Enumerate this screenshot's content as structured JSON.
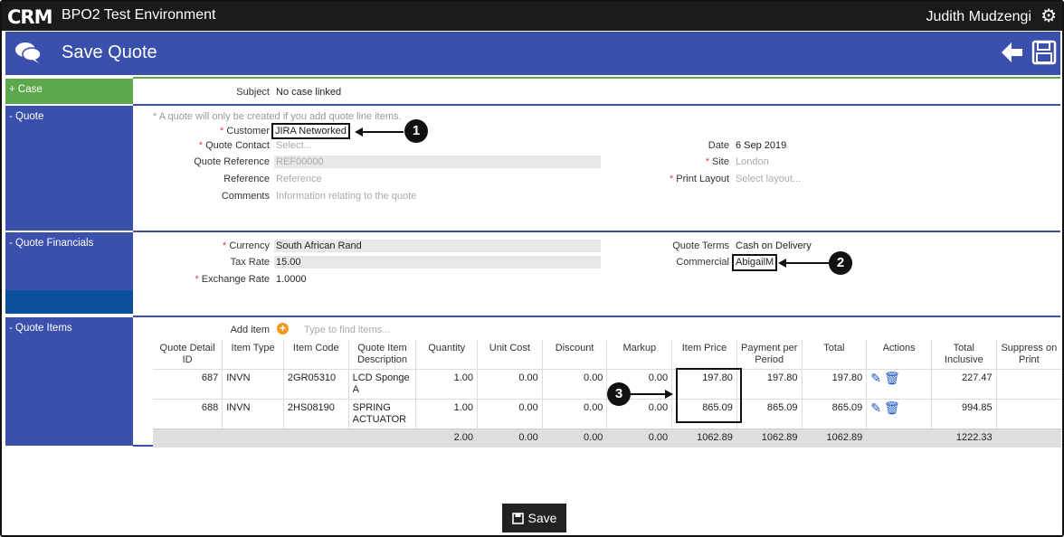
{
  "app": {
    "logo": "CRM",
    "environment": "BPO2 Test Environment",
    "user": "Judith Mudzengi"
  },
  "header": {
    "title": "Save Quote"
  },
  "sections": {
    "case": {
      "label": "+ Case",
      "subject_label": "Subject",
      "subject_value": "No case linked"
    },
    "quote": {
      "label": "- Quote",
      "note": "* A quote will only be created if you add quote line items.",
      "customer_label": "Customer",
      "customer_value": "JIRA Networked",
      "contact_label": "Quote Contact",
      "contact_placeholder": "Select...",
      "reference_label": "Quote Reference",
      "reference_placeholder": "REF00000",
      "ref_label": "Reference",
      "ref_placeholder": "Reference",
      "comments_label": "Comments",
      "comments_placeholder": "Information relating to the quote",
      "date_label": "Date",
      "date_value": "6 Sep 2019",
      "site_label": "Site",
      "site_value": "London",
      "print_label": "Print Layout",
      "print_placeholder": "Select layout..."
    },
    "financials": {
      "label": "- Quote Financials",
      "currency_label": "Currency",
      "currency_value": "South African Rand",
      "tax_label": "Tax Rate",
      "tax_value": "15.00",
      "exchange_label": "Exchange Rate",
      "exchange_value": "1.0000",
      "terms_label": "Quote Terms",
      "terms_value": "Cash on Delivery",
      "commercial_label": "Commercial",
      "commercial_value": "AbigailM"
    },
    "items": {
      "label": "- Quote Items",
      "add_label": "Add item",
      "add_placeholder": "Type to find items...",
      "columns": [
        "Quote Detail ID",
        "Item Type",
        "Item Code",
        "Quote Item Description",
        "Quantity",
        "Unit Cost",
        "Discount",
        "Markup",
        "Item Price",
        "Payment per Period",
        "Total",
        "Actions",
        "Total Inclusive",
        "Suppress on Print"
      ],
      "rows": [
        {
          "id": "687",
          "type": "INVN",
          "code": "2GR05310",
          "desc": "LCD Sponge A",
          "qty": "1.00",
          "unit_cost": "0.00",
          "discount": "0.00",
          "markup": "0.00",
          "price": "197.80",
          "ppp": "197.80",
          "total": "197.80",
          "total_incl": "227.47"
        },
        {
          "id": "688",
          "type": "INVN",
          "code": "2HS08190",
          "desc": "SPRING ACTUATOR",
          "qty": "1.00",
          "unit_cost": "0.00",
          "discount": "0.00",
          "markup": "0.00",
          "price": "865.09",
          "ppp": "865.09",
          "total": "865.09",
          "total_incl": "994.85"
        }
      ],
      "totals": {
        "qty": "2.00",
        "unit_cost": "0.00",
        "discount": "0.00",
        "markup": "0.00",
        "price": "1062.89",
        "ppp": "1062.89",
        "total": "1062.89",
        "total_incl": "1222.33"
      }
    }
  },
  "callouts": [
    "1",
    "2",
    "3"
  ],
  "footer": {
    "save_label": "Save"
  },
  "colors": {
    "accent": "#3b50ad",
    "case_green": "#5ca84a",
    "dark_bar": "#1a1a1a"
  }
}
